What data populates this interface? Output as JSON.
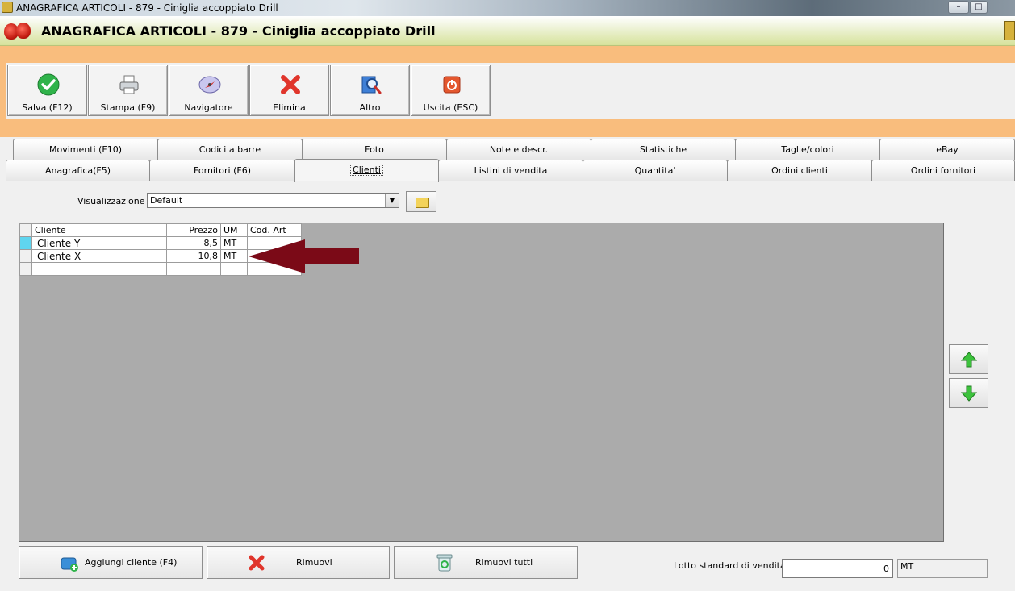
{
  "window": {
    "title": "ANAGRAFICA ARTICOLI - 879 - Ciniglia accoppiato Drill"
  },
  "header": {
    "title": "ANAGRAFICA ARTICOLI - 879 - Ciniglia accoppiato Drill"
  },
  "toolbar": [
    {
      "label": "Salva (F12)",
      "icon": "check-icon"
    },
    {
      "label": "Stampa (F9)",
      "icon": "printer-icon"
    },
    {
      "label": "Navigatore",
      "icon": "compass-icon"
    },
    {
      "label": "Elimina",
      "icon": "delete-x-icon"
    },
    {
      "label": "Altro",
      "icon": "magnifier-icon"
    },
    {
      "label": "Uscita (ESC)",
      "icon": "power-icon"
    }
  ],
  "tabs_row1": [
    "Movimenti (F10)",
    "Codici a barre",
    "Foto",
    "Note e descr.",
    "Statistiche",
    "Taglie/colori",
    "eBay"
  ],
  "tabs_row2": [
    "Anagrafica(F5)",
    "Fornitori (F6)",
    "Clienti",
    "Listini di vendita",
    "Quantita'",
    "Ordini clienti",
    "Ordini fornitori"
  ],
  "active_tab": "Clienti",
  "view": {
    "label": "Visualizzazione :",
    "selected": "Default"
  },
  "grid": {
    "columns": [
      "Cliente",
      "Prezzo",
      "UM",
      "Cod. Art"
    ],
    "rows": [
      {
        "cliente": "Cliente Y",
        "prezzo": "8,5",
        "um": "MT",
        "cod_art": ""
      },
      {
        "cliente": "Cliente X",
        "prezzo": "10,8",
        "um": "MT",
        "cod_art": ""
      }
    ]
  },
  "buttons": {
    "add": "Aggiungi cliente (F4)",
    "remove": "Rimuovi",
    "remove_all": "Rimuovi tutti"
  },
  "lotto": {
    "label": "Lotto standard di vendita :",
    "value": "0",
    "um": "MT"
  },
  "colors": {
    "header_orange": "#f9bd7d",
    "selected_row": "#5fd5ef",
    "arrow": "#7b0a17"
  }
}
